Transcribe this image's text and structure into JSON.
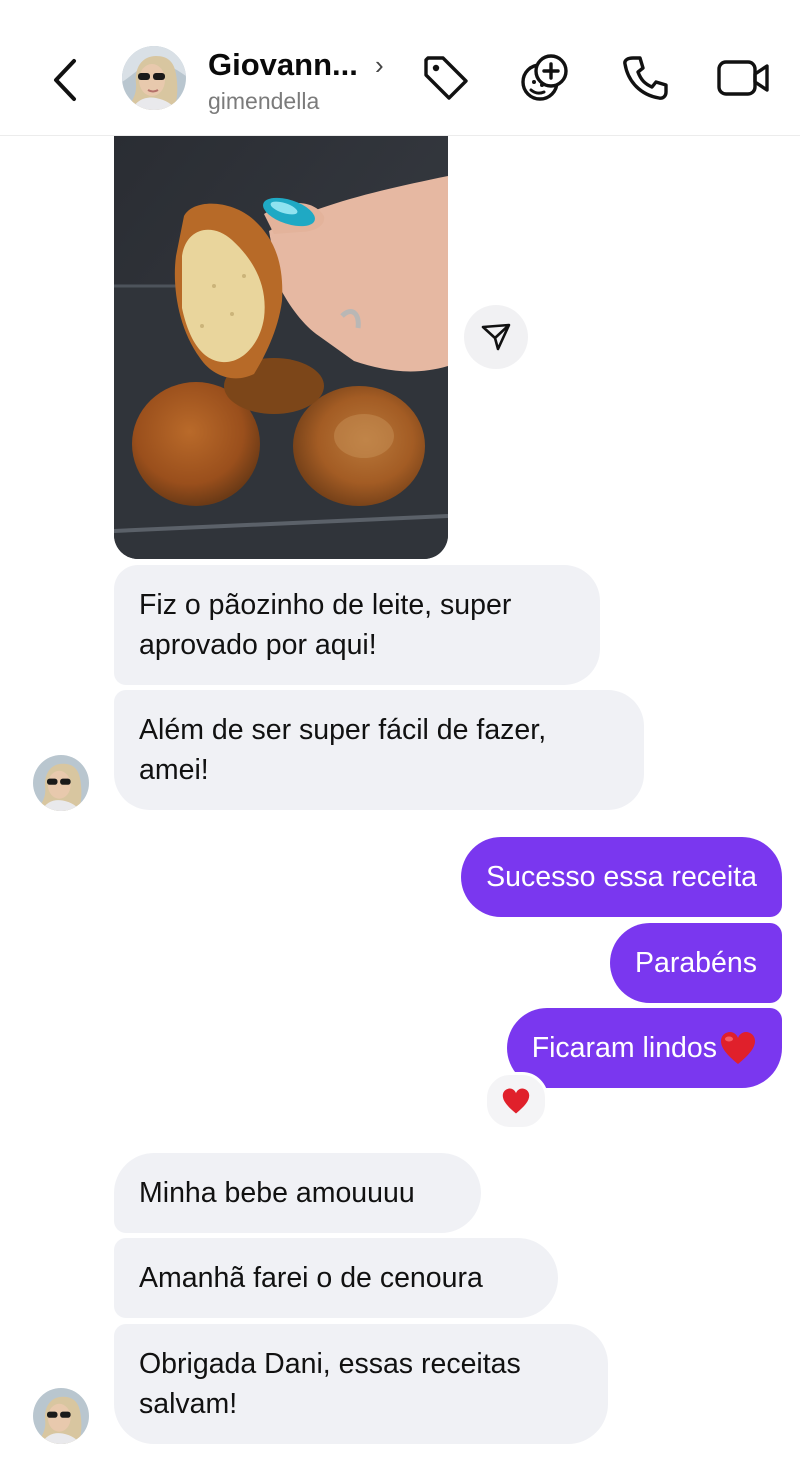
{
  "header": {
    "name": "Giovann...",
    "chevron": "›",
    "handle": "gimendella",
    "icons": [
      "back-icon",
      "tag-icon",
      "effects-icon",
      "phone-icon",
      "video-icon"
    ]
  },
  "messages": {
    "received_1": "Fiz o pãozinho de leite, super aprovado por aqui!",
    "received_2": "Além de ser super fácil de fazer, amei!",
    "sent_1": "Sucesso essa receita",
    "sent_2": "Parabéns",
    "sent_3": "Ficaram lindos",
    "received_3": "Minha bebe amouuuu",
    "received_4": "Amanhã farei o de cenoura",
    "received_5": "Obrigada Dani, essas receitas salvam!"
  },
  "colors": {
    "sent_bubble": "#7a37ef",
    "received_bubble": "#f0f1f5",
    "heart": "#e0202b"
  }
}
